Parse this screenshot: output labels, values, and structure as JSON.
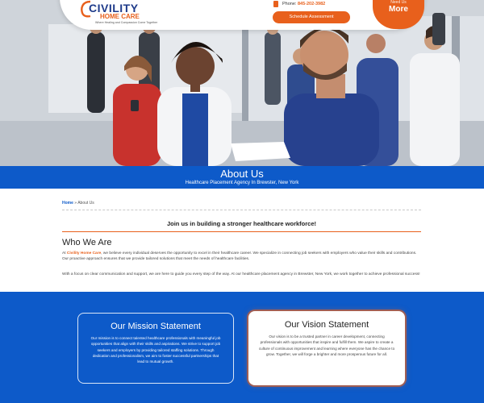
{
  "header": {
    "logo_name": "CIVILITY",
    "logo_sub": "HOME CARE",
    "logo_tagline": "Where Healing and Compassion Come Together",
    "phone_label": "Phone:",
    "phone_number": "845-202-3982",
    "schedule_label": "Schedule Assessment",
    "more_small": "Need Us",
    "more_label": "More"
  },
  "about": {
    "title": "About Us",
    "subtitle": "Healthcare Placement Agency In Brewster, New York"
  },
  "breadcrumb": {
    "home": "Home",
    "separator": " » ",
    "current": "About Us"
  },
  "join": "Join us in building a stronger healthcare workforce!",
  "who": {
    "title": "Who We Are",
    "p1_prefix": "At ",
    "p1_brand": "Civility Home Care",
    "p1_rest": ", we believe every individual deserves the opportunity to excel in their healthcare career. We specialize in connecting job seekers with employers who value their skills and contributions. Our proactive approach ensures that we provide tailored solutions that meet the needs of healthcare facilities.",
    "p2": "With a focus on clear communication and support, we are here to guide you every step of the way. At our healthcare placement agency in Brewster, New York, we work together to achieve professional success!"
  },
  "mission": {
    "title": "Our Mission Statement",
    "text": "Our mission is to connect talented healthcare professionals with meaningful job opportunities that align with their skills and aspirations. We strive to support job seekers and employers by providing tailored staffing solutions. Through dedication and professionalism, we aim to foster successful partnerships that lead to mutual growth."
  },
  "vision": {
    "title": "Our Vision Statement",
    "text": "Our vision is to be a trusted partner in career development, connecting professionals with opportunities that inspire and fulfill them. We aspire to create a culture of continuous improvement and learning where everyone has the chance to grow. Together, we will forge a brighter and more prosperous future for all."
  },
  "colors": {
    "brand_blue": "#0d5ac9",
    "brand_orange": "#e8601c"
  }
}
